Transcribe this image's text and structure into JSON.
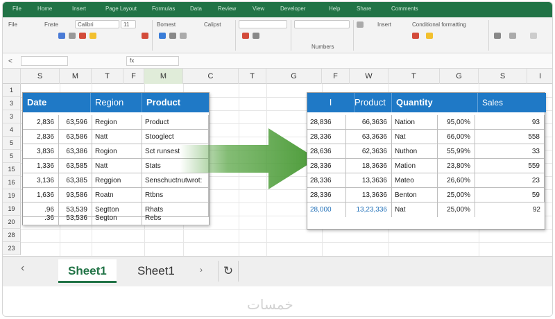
{
  "ribbon": {
    "tabs": [
      "File",
      "Home",
      "Insert",
      "Page Layout",
      "Formulas",
      "Data",
      "Review",
      "View",
      "Developer",
      "Help",
      "Share",
      "Comments"
    ],
    "labels": [
      "File",
      "Fnste",
      "Bomest",
      "Calipst",
      "Numbers",
      "Insert",
      "Conditional formatting"
    ],
    "font_box": "Calibri",
    "size_box": "11"
  },
  "formula_bar": {
    "name_box": "",
    "fx": "fx"
  },
  "columns": [
    "S",
    "M",
    "T",
    "F",
    "M",
    "C",
    "T",
    "G",
    "F",
    "W",
    "T",
    "G",
    "S",
    "I"
  ],
  "rows": [
    "1",
    "3",
    "3",
    "4",
    "5",
    "5",
    "15",
    "16",
    "19",
    "19",
    "20",
    "28",
    "23"
  ],
  "left_table": {
    "headers": [
      "Date",
      "Region",
      "Product"
    ],
    "rows": [
      [
        "2,836",
        "63,596",
        "Region",
        "Product"
      ],
      [
        "2,836",
        "63,586",
        "Natt",
        "Stooglect"
      ],
      [
        "3,836",
        "63,386",
        "Rogion",
        "Sct runsest"
      ],
      [
        "1,336",
        "63,585",
        "Natt",
        "Stats"
      ],
      [
        "3,136",
        "63,385",
        "Reggion",
        "Senschuctnutwrot:"
      ],
      [
        "1,636",
        "93,586",
        "Roatn",
        "Rtbns"
      ],
      [
        ".96",
        "53,539",
        "Segtton",
        "Rhats"
      ],
      [
        ".36",
        "53,536",
        "Segton",
        "Rebs"
      ]
    ]
  },
  "right_table": {
    "headers": [
      "I",
      "Product",
      "Quantity",
      "Sales"
    ],
    "rows": [
      [
        "28,836",
        "66,3636",
        "Nation",
        "95,00%",
        "93"
      ],
      [
        "28,336",
        "63,3636",
        "Nat",
        "66,00%",
        "558"
      ],
      [
        "28,636",
        "62,3636",
        "Nuthon",
        "55,99%",
        "33"
      ],
      [
        "28,336",
        "18,3636",
        "Mation",
        "23,80%",
        "559"
      ],
      [
        "28,336",
        "13,3636",
        "Mateo",
        "26,60%",
        "23"
      ],
      [
        "28,336",
        "13,3636",
        "Benton",
        "25,00%",
        "59"
      ],
      [
        "28,000",
        "13,23,336",
        "Nat",
        "25,00%",
        "92"
      ]
    ]
  },
  "sheet_tabs": {
    "active": "Sheet1",
    "other": "Sheet1",
    "prev": "‹",
    "next": "›",
    "add": "↻"
  },
  "watermark": "خمسات",
  "colors": {
    "accent": "#217346",
    "table_header": "#1f79c6",
    "arrow": "#5aa646"
  }
}
